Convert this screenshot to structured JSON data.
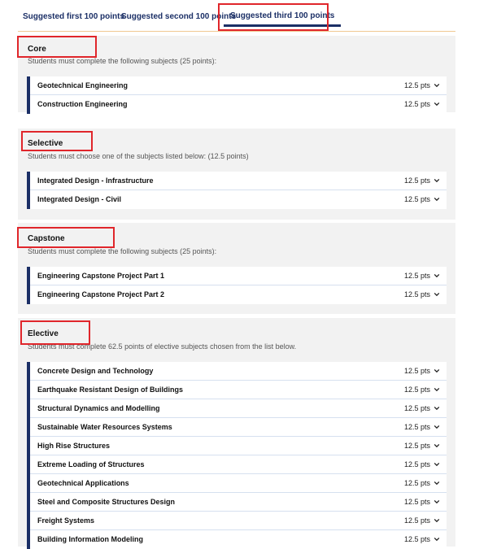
{
  "tabs": [
    {
      "label": "Suggested first 100 points"
    },
    {
      "label": "Suggested second 100 points"
    },
    {
      "label": "Suggested third 100 points",
      "selected": true
    }
  ],
  "sections": [
    {
      "title": "Core",
      "description": "Students must complete the following subjects (25 points):",
      "subjects": [
        {
          "name": "Geotechnical Engineering",
          "points": "12.5 pts"
        },
        {
          "name": "Construction Engineering",
          "points": "12.5 pts"
        }
      ]
    },
    {
      "title": "Selective",
      "description": "Students must choose one of the subjects listed below: (12.5 points)",
      "subjects": [
        {
          "name": "Integrated Design - Infrastructure",
          "points": "12.5 pts"
        },
        {
          "name": "Integrated Design - Civil",
          "points": "12.5 pts"
        }
      ]
    },
    {
      "title": "Capstone",
      "description": "Students must complete the following subjects (25 points):",
      "subjects": [
        {
          "name": "Engineering Capstone Project Part 1",
          "points": "12.5 pts"
        },
        {
          "name": "Engineering Capstone Project Part 2",
          "points": "12.5 pts"
        }
      ]
    },
    {
      "title": "Elective",
      "description": "Students must complete 62.5 points of elective subjects chosen from the list below.",
      "subjects": [
        {
          "name": "Concrete Design and Technology",
          "points": "12.5 pts"
        },
        {
          "name": "Earthquake Resistant Design of Buildings",
          "points": "12.5 pts"
        },
        {
          "name": "Structural Dynamics and Modelling",
          "points": "12.5 pts"
        },
        {
          "name": "Sustainable Water Resources Systems",
          "points": "12.5 pts"
        },
        {
          "name": "High Rise Structures",
          "points": "12.5 pts"
        },
        {
          "name": "Extreme Loading of Structures",
          "points": "12.5 pts"
        },
        {
          "name": "Geotechnical Applications",
          "points": "12.5 pts"
        },
        {
          "name": "Steel and Composite Structures Design",
          "points": "12.5 pts"
        },
        {
          "name": "Freight Systems",
          "points": "12.5 pts"
        },
        {
          "name": "Building Information Modeling",
          "points": "12.5 pts"
        }
      ]
    }
  ],
  "colors": {
    "accent": "#1b2f66",
    "highlight": "#e0262b",
    "section_bg": "#f2f2f2",
    "tab_divider": "#f0c892"
  }
}
